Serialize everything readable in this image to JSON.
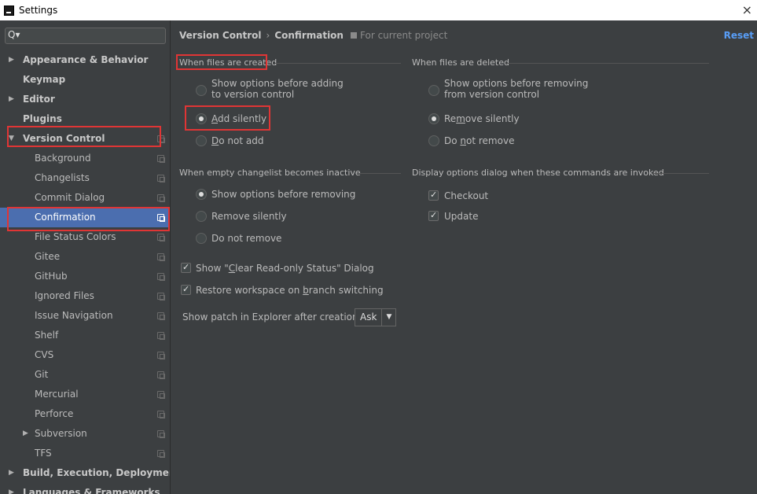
{
  "window": {
    "title": "Settings",
    "close": "×"
  },
  "search": {
    "icon": "Q▾"
  },
  "tree": [
    {
      "label": "Appearance & Behavior",
      "arrow": "▶"
    },
    {
      "label": "Keymap",
      "arrow": ""
    },
    {
      "label": "Editor",
      "arrow": "▶"
    },
    {
      "label": "Plugins",
      "arrow": ""
    },
    {
      "label": "Version Control",
      "arrow": "▼"
    },
    {
      "label": "Background"
    },
    {
      "label": "Changelists"
    },
    {
      "label": "Commit Dialog"
    },
    {
      "label": "Confirmation"
    },
    {
      "label": "File Status Colors"
    },
    {
      "label": "Gitee"
    },
    {
      "label": "GitHub"
    },
    {
      "label": "Ignored Files"
    },
    {
      "label": "Issue Navigation"
    },
    {
      "label": "Shelf"
    },
    {
      "label": "CVS"
    },
    {
      "label": "Git"
    },
    {
      "label": "Mercurial"
    },
    {
      "label": "Perforce"
    },
    {
      "label": "Subversion",
      "arrow": "▶"
    },
    {
      "label": "TFS"
    },
    {
      "label": "Build, Execution, Deployment",
      "arrow": "▶"
    },
    {
      "label": "Languages & Frameworks",
      "arrow": "▶"
    }
  ],
  "header": {
    "crumb1": "Version Control",
    "sep": "›",
    "crumb2": "Confirmation",
    "scope": "For current project",
    "reset": "Reset"
  },
  "created": {
    "title": "When files are created",
    "opt1_line1": "Show options before adding",
    "opt1_line2": "to version control",
    "opt2": "dd silently",
    "opt2_mn": "A",
    "opt3": "o not add",
    "opt3_mn": "D"
  },
  "deleted": {
    "title": "When files are deleted",
    "opt1_line1": "Show options before removing",
    "opt1_line2": "from version control",
    "opt2_a": "Re",
    "opt2_mn": "m",
    "opt2_b": "ove silently",
    "opt3_a": "Do ",
    "opt3_mn": "n",
    "opt3_b": "ot remove"
  },
  "changelist": {
    "title": "When empty changelist becomes inactive",
    "opt1": "Show options before removing",
    "opt2": "Remove silently",
    "opt3": "Do not remove"
  },
  "commands": {
    "title": "Display options dialog when these commands are invoked",
    "opt1": "Checkout",
    "opt2": "Update"
  },
  "misc": {
    "readonly_a": "Show \"",
    "readonly_mn": "C",
    "readonly_b": "lear Read-only Status\" Dialog",
    "restore_a": "Restore workspace on ",
    "restore_mn": "b",
    "restore_b": "ranch switching",
    "patch_label": "Show patch in Explorer after creation:",
    "patch_value": "Ask",
    "patch_arrow": "▼"
  }
}
